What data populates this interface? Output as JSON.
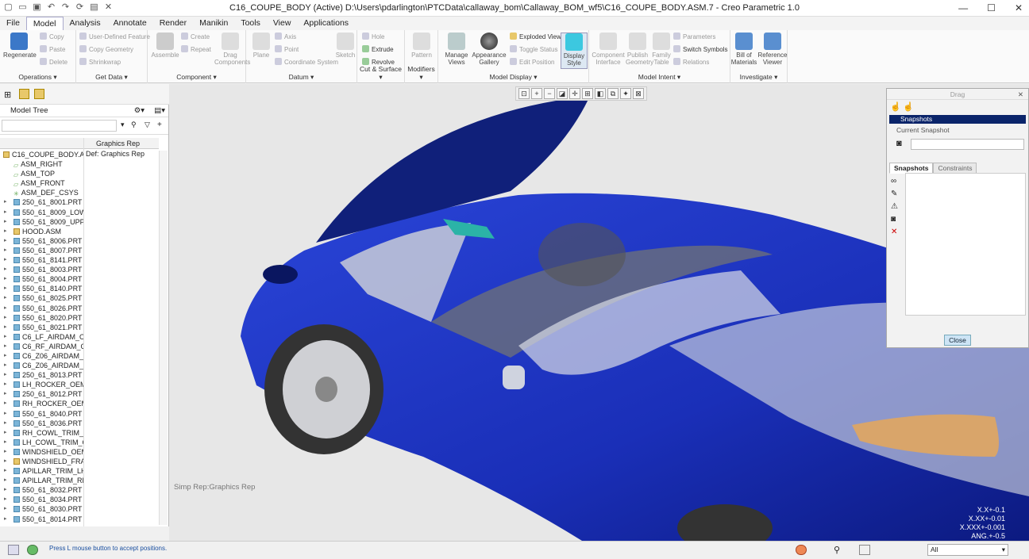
{
  "window": {
    "title": "C16_COUPE_BODY (Active) D:\\Users\\pdarlington\\PTCData\\callaway_bom\\Callaway_BOM_wf5\\C16_COUPE_BODY.ASM.7 - Creo Parametric 1.0"
  },
  "menu": {
    "tabs": [
      "File",
      "Model",
      "Analysis",
      "Annotate",
      "Render",
      "Manikin",
      "Tools",
      "View",
      "Applications"
    ]
  },
  "ribbon": {
    "operations": {
      "regenerate": "Regenerate",
      "copy": "Copy",
      "paste": "Paste",
      "delete": "Delete",
      "label": "Operations"
    },
    "get_data": {
      "udf": "User-Defined Feature",
      "copy_geom": "Copy Geometry",
      "shrinkwrap": "Shrinkwrap",
      "label": "Get Data"
    },
    "component": {
      "assemble": "Assemble",
      "create": "Create",
      "repeat": "Repeat",
      "drag": "Drag Components",
      "label": "Component"
    },
    "datum": {
      "plane": "Plane",
      "axis": "Axis",
      "point": "Point",
      "csys": "Coordinate System",
      "sketch": "Sketch",
      "label": "Datum"
    },
    "cut_surface": {
      "hole": "Hole",
      "extrude": "Extrude",
      "revolve": "Revolve",
      "label": "Cut & Surface"
    },
    "modifiers": {
      "pattern": "Pattern",
      "label": "Modifiers"
    },
    "model_display": {
      "manage_views": "Manage Views",
      "appearance": "Appearance Gallery",
      "exploded": "Exploded View",
      "toggle": "Toggle Status",
      "edit_pos": "Edit Position",
      "display_style": "Display Style",
      "label": "Model Display"
    },
    "model_intent": {
      "comp_iface": "Component Interface",
      "publish": "Publish Geometry",
      "family": "Family Table",
      "params": "Parameters",
      "switch": "Switch Symbols",
      "relations": "Relations",
      "label": "Model Intent"
    },
    "investigate": {
      "bom": "Bill of Materials",
      "ref_viewer": "Reference Viewer",
      "label": "Investigate"
    }
  },
  "tree": {
    "title": "Model Tree",
    "col2_header": "Graphics Rep",
    "root": "C16_COUPE_BODY.A",
    "root_rep": "Def: Graphics Rep",
    "items": [
      {
        "label": "ASM_RIGHT",
        "kind": "datum"
      },
      {
        "label": "ASM_TOP",
        "kind": "datum"
      },
      {
        "label": "ASM_FRONT",
        "kind": "datum"
      },
      {
        "label": "ASM_DEF_CSYS",
        "kind": "csys"
      },
      {
        "label": "250_61_8001.PRT",
        "kind": "part"
      },
      {
        "label": "550_61_8009_LOW",
        "kind": "part"
      },
      {
        "label": "550_61_8009_UPP",
        "kind": "part"
      },
      {
        "label": "HOOD.ASM",
        "kind": "asm"
      },
      {
        "label": "550_61_8006.PRT",
        "kind": "part"
      },
      {
        "label": "550_61_8007.PRT",
        "kind": "part"
      },
      {
        "label": "550_61_8141.PRT",
        "kind": "part"
      },
      {
        "label": "550_61_8003.PRT",
        "kind": "part"
      },
      {
        "label": "550_61_8004.PRT",
        "kind": "part"
      },
      {
        "label": "550_61_8140.PRT",
        "kind": "part"
      },
      {
        "label": "550_61_8025.PRT",
        "kind": "part"
      },
      {
        "label": "550_61_8026.PRT",
        "kind": "part"
      },
      {
        "label": "550_61_8020.PRT",
        "kind": "part"
      },
      {
        "label": "550_61_8021.PRT",
        "kind": "part"
      },
      {
        "label": "C6_LF_AIRDAM_O",
        "kind": "part"
      },
      {
        "label": "C6_RF_AIRDAM_O",
        "kind": "part"
      },
      {
        "label": "C6_Z06_AIRDAM_C",
        "kind": "part"
      },
      {
        "label": "C6_Z06_AIRDAM_C",
        "kind": "part"
      },
      {
        "label": "250_61_8013.PRT",
        "kind": "part"
      },
      {
        "label": "LH_ROCKER_OEM",
        "kind": "part"
      },
      {
        "label": "250_61_8012.PRT",
        "kind": "part"
      },
      {
        "label": "RH_ROCKER_OEM",
        "kind": "part"
      },
      {
        "label": "550_61_8040.PRT",
        "kind": "part"
      },
      {
        "label": "550_61_8036.PRT",
        "kind": "part"
      },
      {
        "label": "RH_COWL_TRIM_C",
        "kind": "part"
      },
      {
        "label": "LH_COWL_TRIM_C",
        "kind": "part"
      },
      {
        "label": "WINDSHIELD_OEM",
        "kind": "part"
      },
      {
        "label": "WINDSHIELD_FRA",
        "kind": "asm"
      },
      {
        "label": "APILLAR_TRIM_LH",
        "kind": "part"
      },
      {
        "label": "APILLAR_TRIM_RH",
        "kind": "part"
      },
      {
        "label": "550_61_8032.PRT",
        "kind": "part"
      },
      {
        "label": "550_61_8034.PRT",
        "kind": "part"
      },
      {
        "label": "550_61_8030.PRT",
        "kind": "part"
      },
      {
        "label": "550_61_8014.PRT",
        "kind": "part"
      }
    ]
  },
  "viewport": {
    "simp_rep": "Simp Rep:Graphics Rep",
    "tolerances": [
      "X.X+-0.1",
      "X.XX+-0.01",
      "X.XXX+-0.001",
      "ANG.+-0.5"
    ],
    "body_color": "#1a2fb8"
  },
  "drag_dialog": {
    "title": "Drag",
    "snapshots": "Snapshots",
    "current": "Current Snapshot",
    "tab_snapshots": "Snapshots",
    "tab_constraints": "Constraints",
    "close": "Close"
  },
  "status": {
    "message": "Press L mouse button to accept positions.",
    "filter": "All"
  }
}
